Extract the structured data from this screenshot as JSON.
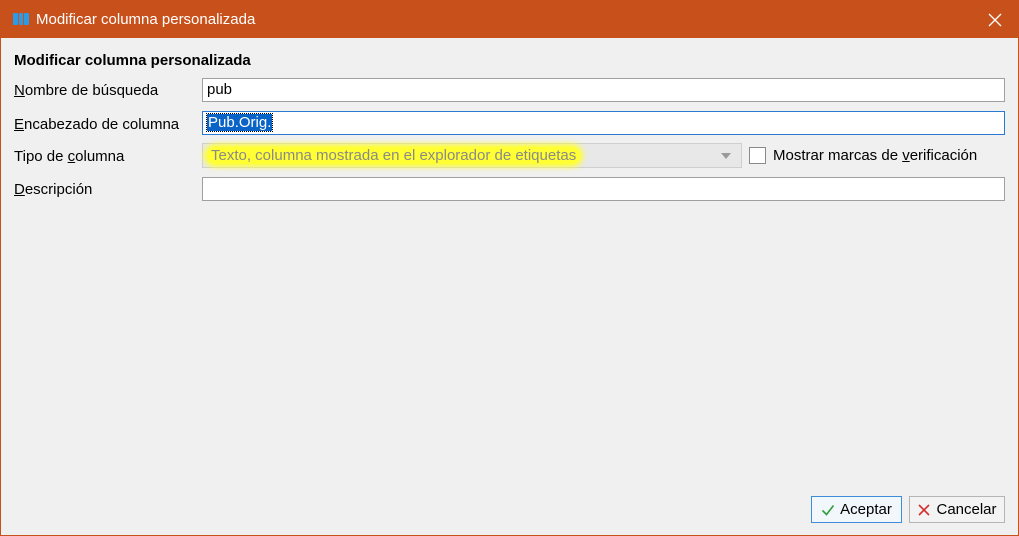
{
  "window": {
    "title": "Modificar columna personalizada",
    "accent_color": "#c8501a",
    "icon": "columns-icon"
  },
  "form": {
    "heading": "Modificar columna personalizada",
    "lookup_name": {
      "label_first": "N",
      "label_rest": "ombre de búsqueda",
      "value": "pub"
    },
    "column_heading": {
      "label_first": "E",
      "label_rest": "ncabezado de columna",
      "value": "Pub.Orig."
    },
    "column_type": {
      "label_pre": "Tipo de ",
      "label_underline": "c",
      "label_post": "olumna",
      "value": "Texto, columna mostrada en el explorador de etiquetas",
      "highlight_color": "#ffff33"
    },
    "show_checkmarks": {
      "label_pre": "Mostrar marcas de ",
      "label_underline": "v",
      "label_post": "erificación",
      "checked": false
    },
    "description": {
      "label_first": "D",
      "label_rest": "escripción",
      "value": ""
    }
  },
  "buttons": {
    "ok_label": "Aceptar",
    "cancel_label": "Cancelar"
  }
}
